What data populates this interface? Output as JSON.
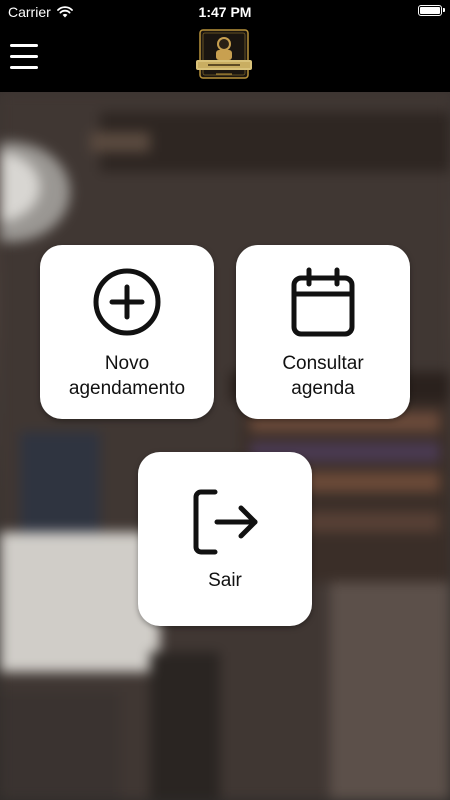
{
  "status_bar": {
    "carrier": "Carrier",
    "time": "1:47 PM"
  },
  "header": {
    "menu_icon": "hamburger-menu-icon",
    "logo_icon": "barbershop-logo"
  },
  "cards": {
    "novo": {
      "icon": "plus-circle-icon",
      "label_line1": "Novo",
      "label_line2": "agendamento"
    },
    "consultar": {
      "icon": "calendar-icon",
      "label_line1": "Consultar",
      "label_line2": "agenda"
    },
    "sair": {
      "icon": "logout-icon",
      "label": "Sair"
    }
  },
  "colors": {
    "header_bg": "#000000",
    "card_bg": "#ffffff",
    "icon_color": "#111111"
  }
}
